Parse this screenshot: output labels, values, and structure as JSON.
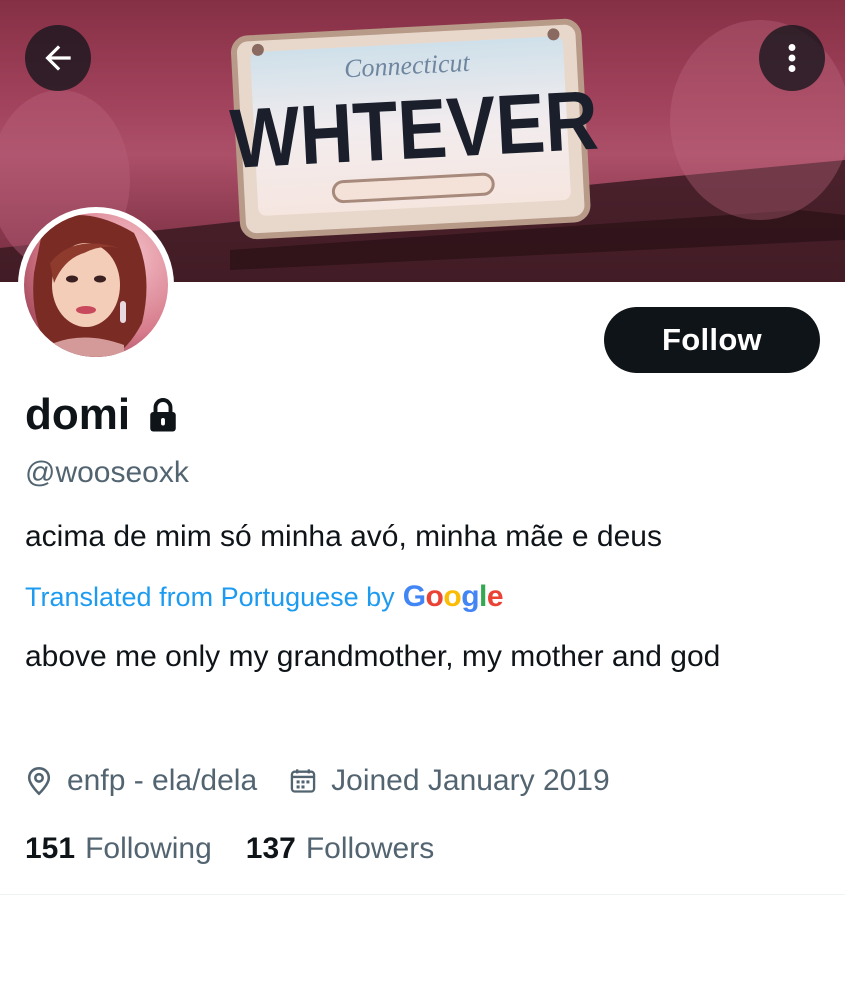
{
  "banner": {
    "plate_state": "Connecticut",
    "plate_text": "WHTEVER"
  },
  "header": {
    "back_icon": "arrow-left-icon",
    "more_icon": "more-vertical-icon"
  },
  "profile": {
    "display_name": "domi",
    "protected_icon": "lock-icon",
    "handle": "@wooseoxk",
    "bio": "acima de mim só minha avó, minha mãe e deus",
    "translated_prefix": "Translated from Portuguese by",
    "translation_provider": "Google",
    "bio_translation": "above me only my grandmother, my mother and god",
    "location": "enfp - ela/dela",
    "joined": "Joined January 2019",
    "following_count": "151",
    "following_label": "Following",
    "followers_count": "137",
    "followers_label": "Followers"
  },
  "actions": {
    "follow_label": "Follow"
  },
  "colors": {
    "accent": "#1d9bf0",
    "text_primary": "#0f1419",
    "text_secondary": "#536471",
    "button_dark": "#0f1419"
  }
}
